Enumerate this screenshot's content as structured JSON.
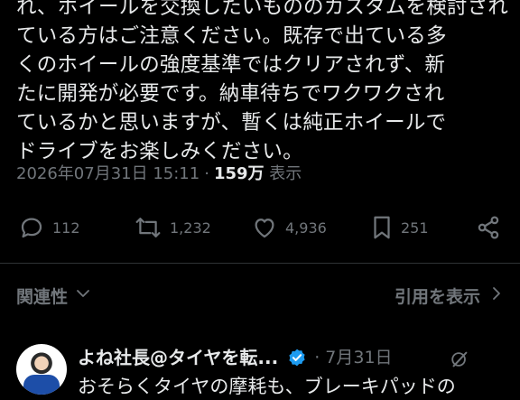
{
  "post": {
    "lines": [
      "れ、ホイールを交換したいもののカスタムを検討され",
      "ている方はご注意ください。既存で出ている多",
      "くのホイールの強度基準ではクリアされず、新",
      "たに開発が必要です。納車待ちでワクワクされ",
      "ているかと思いますが、暫くは純正ホイールで",
      "ドライブをお楽しみください。"
    ],
    "timestamp": "2026年07月31日 15:11",
    "separator": "·",
    "views_count": "159万",
    "views_label": "表示"
  },
  "actions": {
    "replies": "112",
    "reposts": "1,232",
    "likes": "4,936",
    "bookmarks": "251"
  },
  "related": {
    "label": "関連性",
    "quotes_link": "引用を表示"
  },
  "reply": {
    "name": "よね社長@タイヤを転...",
    "date": "· 7月31日",
    "text": "おそらくタイヤの摩耗も、ブレーキパッドの"
  },
  "colors": {
    "background": "#000000",
    "text": "#e7e9ea",
    "muted": "#71767b",
    "divider": "#2f3336",
    "verified": "#1d9bf0"
  }
}
